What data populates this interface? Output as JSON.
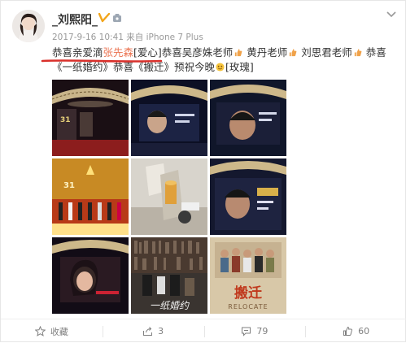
{
  "user": {
    "name": "_刘熙阳_"
  },
  "meta": {
    "time": "2017-9-16 10:41",
    "source_prefix": "来自",
    "source": "iPhone 7 Plus"
  },
  "post": {
    "t1": "恭喜亲爱滴",
    "t2": "张先森",
    "t3": "[爱心]恭喜吴彦姝老师",
    "t4": " 黄丹老师",
    "t5": " 刘思君老师",
    "t6": " 恭喜《一纸婚约》恭喜《搬迁》预祝今晚",
    "t7": "[玫瑰]"
  },
  "images": [
    {
      "name": "thumb-award-stage"
    },
    {
      "name": "thumb-screen-closeup"
    },
    {
      "name": "thumb-screen-portrait"
    },
    {
      "name": "thumb-golden-stage"
    },
    {
      "name": "thumb-trophy-table"
    },
    {
      "name": "thumb-screen-actor"
    },
    {
      "name": "thumb-screen-actress"
    },
    {
      "name": "thumb-bookshelf-poster"
    },
    {
      "name": "thumb-relocate-poster"
    }
  ],
  "poster_texts": {
    "p8": "一纸婚约",
    "p9a": "搬迁",
    "p9b": "RELOCATE"
  },
  "actions": {
    "favorite": "收藏",
    "repost": "3",
    "comment": "79",
    "like": "60"
  },
  "colors": {
    "highlight": "#eb7350",
    "underline": "#d9302b",
    "meta": "#999999"
  }
}
